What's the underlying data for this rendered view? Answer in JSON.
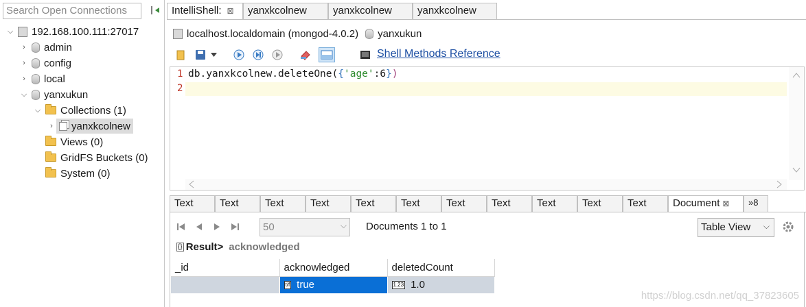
{
  "sidebar": {
    "search_placeholder": "Search Open Connections",
    "server": "192.168.100.111:27017",
    "databases": [
      "admin",
      "config",
      "local",
      "yanxukun"
    ],
    "collections_label": "Collections (1)",
    "collection_item": "yanxkcolnew",
    "views_label": "Views (0)",
    "gridfs_label": "GridFS Buckets (0)",
    "system_label": "System (0)"
  },
  "tabs": [
    {
      "label": "IntelliShell:",
      "close": "⊠"
    },
    {
      "label": "yanxkcolnew"
    },
    {
      "label": "yanxkcolnew"
    },
    {
      "label": "yanxkcolnew"
    }
  ],
  "connection": {
    "host": "localhost.localdomain (mongod-4.0.2)",
    "database": "yanxukun"
  },
  "toolbar": {
    "shell_ref": "Shell Methods Reference"
  },
  "editor": {
    "line1_no": "1",
    "line2_no": "2",
    "code_pre": "db.yanxkcolnew.deleteOne(",
    "code_brace_open": "{",
    "code_str": "'age'",
    "code_colon_num": ":6",
    "code_brace_close": "}",
    "code_post": ")"
  },
  "result_tabs": {
    "text_tab": "Text",
    "document_tab": "Document",
    "document_close": "⊠",
    "overflow": "»8"
  },
  "pager": {
    "page_size": "50",
    "doc_count": "Documents 1 to 1",
    "view_mode": "Table View"
  },
  "crumb": {
    "result": "Result>",
    "field": "acknowledged"
  },
  "grid": {
    "columns": [
      "_id",
      "acknowledged",
      "deletedCount"
    ],
    "ack_value": "true",
    "deleted_value": "1.0",
    "ack_type_badge": "t/f",
    "deleted_type_badge": "1.23"
  },
  "watermark": "https://blog.csdn.net/qq_37823605"
}
